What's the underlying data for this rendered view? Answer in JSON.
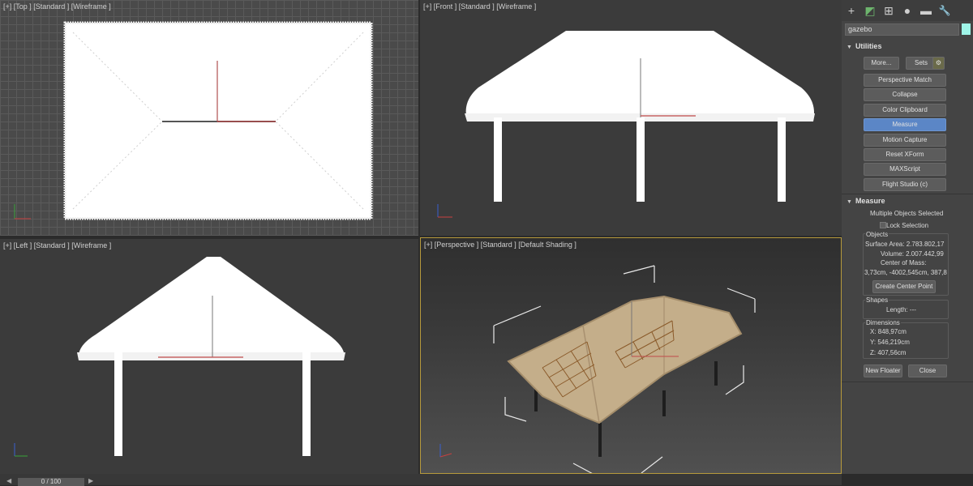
{
  "viewports": {
    "top": {
      "label": "[+] [Top ] [Standard ] [Wireframe ]"
    },
    "front": {
      "label": "[+] [Front ] [Standard ] [Wireframe ]"
    },
    "left": {
      "label": "[+] [Left ] [Standard ] [Wireframe ]"
    },
    "perspective": {
      "label": "[+] [Perspective ] [Standard ] [Default Shading ]"
    }
  },
  "panel": {
    "tabs": [
      {
        "icon": "create-icon",
        "glyph": "+"
      },
      {
        "icon": "modify-icon",
        "glyph": "◩"
      },
      {
        "icon": "hierarchy-icon",
        "glyph": "⊞"
      },
      {
        "icon": "motion-icon",
        "glyph": "●"
      },
      {
        "icon": "display-icon",
        "glyph": "▬"
      },
      {
        "icon": "utilities-icon",
        "glyph": "🔧"
      }
    ],
    "object_name": "gazebo",
    "object_color": "#9ff5e8",
    "utilities": {
      "title": "Utilities",
      "more": "More...",
      "sets": "Sets",
      "buttons": [
        "Perspective Match",
        "Collapse",
        "Color Clipboard",
        "Measure",
        "Motion Capture",
        "Reset XForm",
        "MAXScript",
        "Flight Studio (c)"
      ]
    },
    "measure": {
      "title": "Measure",
      "selection_text": "Multiple Objects Selected",
      "lock_selection": "Lock Selection",
      "objects_label": "Objects",
      "surface_area": "Surface Area: 2.783.802,17",
      "volume": "Volume: 2.007.442,99",
      "center_of_mass_label": "Center of Mass:",
      "center_of_mass_value": "3,73cm, -4002,545cm, 387,8",
      "create_center_point": "Create Center Point",
      "shapes_label": "Shapes",
      "length": "Length: ---",
      "dimensions_label": "Dimensions",
      "dim_x": "X:  848,97cm",
      "dim_y": "Y:  546,219cm",
      "dim_z": "Z:  407,56cm",
      "new_floater": "New Floater",
      "close": "Close"
    }
  },
  "timeline": {
    "frame": "0 / 100"
  }
}
